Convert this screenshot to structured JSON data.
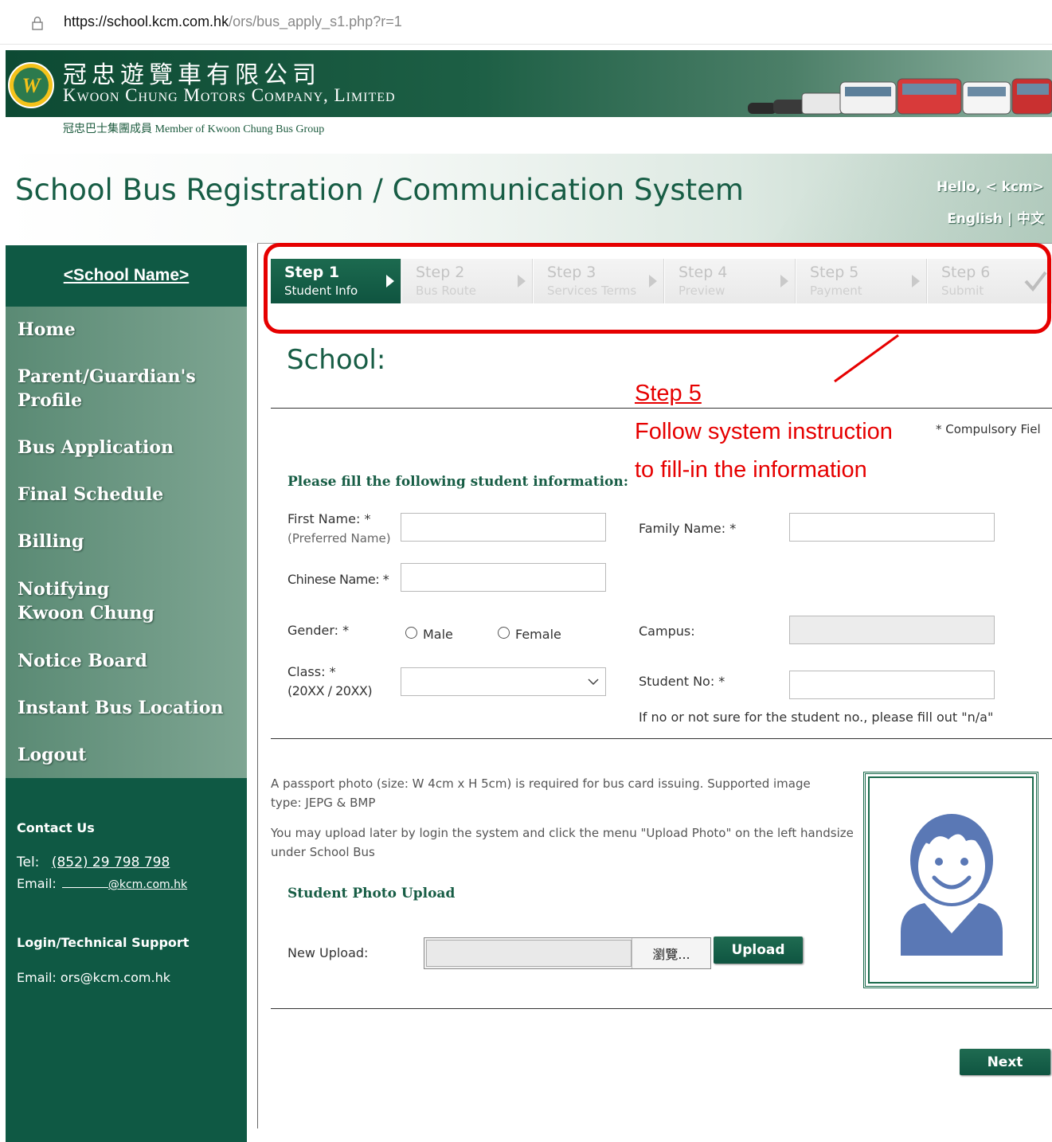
{
  "browser": {
    "url_host": "https://school.kcm.com.hk",
    "url_path": "/ors/bus_apply_s1.php?r=1"
  },
  "banner": {
    "company_cn": "冠忠遊覽車有限公司",
    "company_en": "Kwoon Chung Motors Company, Limited",
    "member_text": "冠忠巴士集團成員  Member of  Kwoon Chung Bus Group"
  },
  "header": {
    "title": "School Bus Registration / Communication System",
    "hello": "Hello, < kcm>",
    "language": "English | 中文"
  },
  "sidebar": {
    "school_name": "<School Name>",
    "items": [
      {
        "label": "Home"
      },
      {
        "label": "Parent/Guardian's"
      },
      {
        "label": "Profile"
      },
      {
        "label": "Bus Application"
      },
      {
        "label": "Final Schedule"
      },
      {
        "label": "Billing"
      },
      {
        "label": "Notifying"
      },
      {
        "label": "Kwoon Chung"
      },
      {
        "label": "Notice Board"
      },
      {
        "label": "Instant Bus Location"
      },
      {
        "label": "Logout"
      }
    ],
    "contact_heading": "Contact Us",
    "tel_label": "Tel:",
    "tel_value": "(852) 29 798 798",
    "email_label": "Email:",
    "email_value": "@kcm.com.hk",
    "support_heading": "Login/Technical Support",
    "support_email": "Email: ors@kcm.com.hk"
  },
  "steps": [
    {
      "title": "Step 1",
      "subtitle": "Student Info",
      "active": true
    },
    {
      "title": "Step 2",
      "subtitle": "Bus Route",
      "active": false
    },
    {
      "title": "Step 3",
      "subtitle": "Services Terms",
      "active": false
    },
    {
      "title": "Step 4",
      "subtitle": "Preview",
      "active": false
    },
    {
      "title": "Step 5",
      "subtitle": "Payment",
      "active": false
    },
    {
      "title": "Step 6",
      "subtitle": "Submit",
      "active": false
    }
  ],
  "annotation": {
    "step": "Step 5",
    "line1": "Follow system instruction",
    "line2": "to fill-in the information",
    "color": "#e60000"
  },
  "form": {
    "school_heading": "School:",
    "compulsory": "* Compulsory Fiel",
    "fill_heading": "Please fill the following student information:",
    "first_name_label": "First Name: *",
    "first_name_sub": "(Preferred Name)",
    "first_name_value": "",
    "family_name_label": "Family Name: *",
    "family_name_value": "",
    "chinese_name_label": "Chinese Name: *",
    "chinese_name_value": "",
    "gender_label": "Gender: *",
    "gender_options": [
      "Male",
      "Female"
    ],
    "campus_label": "Campus:",
    "campus_value": "",
    "class_label": "Class: *",
    "class_sub": "(20XX / 20XX)",
    "class_value": "",
    "student_no_label": "Student No: *",
    "student_no_value": "",
    "student_no_hint": "If no or not sure for the student no., please fill out \"n/a\""
  },
  "photo": {
    "para1": "A passport photo (size: W 4cm x H 5cm) is required for bus card issuing. Supported image type: JEPG & BMP",
    "para2": "You may upload later by login the system and click the menu \"Upload Photo\" on the left handsize under School Bus",
    "heading": "Student Photo Upload",
    "new_upload_label": "New Upload:",
    "browse_label": "瀏覽...",
    "upload_button": "Upload"
  },
  "next_button": "Next",
  "colors": {
    "brand_green": "#0f5944",
    "title_green": "#175d45",
    "highlight_red": "#e60000"
  }
}
